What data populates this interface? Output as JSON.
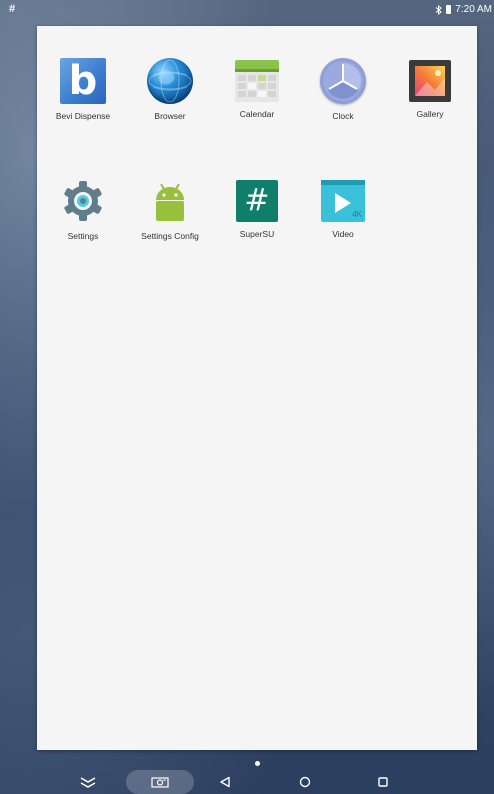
{
  "status_bar": {
    "left_glyph": "#",
    "time": "7:20 AM"
  },
  "apps": [
    {
      "label": "Bevi Dispense",
      "icon": "bevi-icon",
      "glyph": "b"
    },
    {
      "label": "Browser",
      "icon": "globe-icon"
    },
    {
      "label": "Calendar",
      "icon": "calendar-icon"
    },
    {
      "label": "Clock",
      "icon": "clock-icon"
    },
    {
      "label": "Gallery",
      "icon": "gallery-icon"
    },
    {
      "label": "Settings",
      "icon": "gear-icon"
    },
    {
      "label": "Settings Config",
      "icon": "android-icon"
    },
    {
      "label": "SuperSU",
      "icon": "hash-icon",
      "glyph": "#"
    },
    {
      "label": "Video",
      "icon": "video-play-icon",
      "badge": "4K"
    }
  ],
  "nav_bar": {
    "buttons": [
      "hide-bar",
      "screenshot",
      "back",
      "home",
      "recents"
    ]
  },
  "colors": {
    "drawer_bg": "#f5f5f5",
    "label_text": "#333333",
    "supersu_bg": "#0f7f6c",
    "settings_gear": "#607d8b",
    "android_green": "#97c03d",
    "video_bg": "#3ac0d8"
  }
}
